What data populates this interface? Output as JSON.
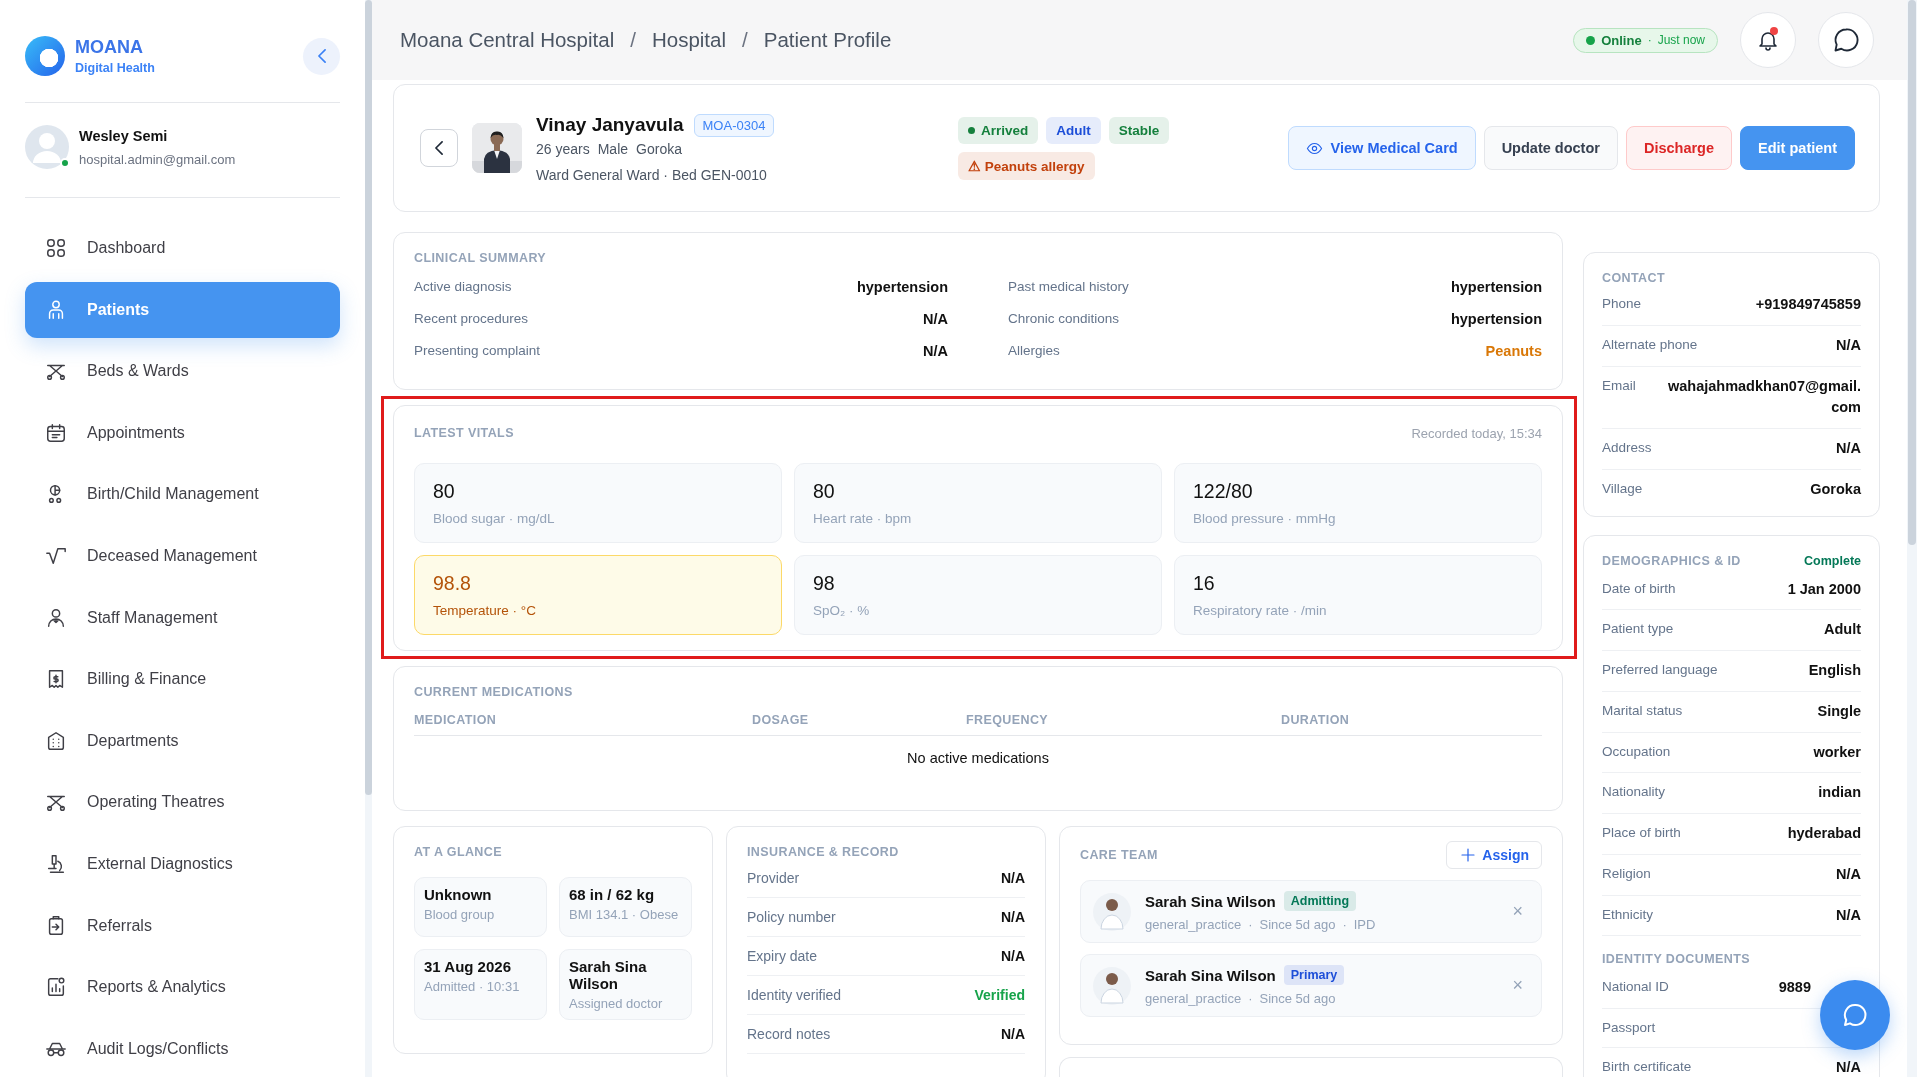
{
  "brand": {
    "name": "MOANA",
    "subtitle": "Digital Health"
  },
  "user": {
    "name": "Wesley Semi",
    "email": "hospital.admin@gmail.com",
    "online": true
  },
  "nav": [
    {
      "label": "Dashboard",
      "selected": false
    },
    {
      "label": "Patients",
      "selected": true
    },
    {
      "label": "Beds & Wards",
      "selected": false
    },
    {
      "label": "Appointments",
      "selected": false
    },
    {
      "label": "Birth/Child Management",
      "selected": false
    },
    {
      "label": "Deceased Management",
      "selected": false
    },
    {
      "label": "Staff Management",
      "selected": false
    },
    {
      "label": "Billing & Finance",
      "selected": false
    },
    {
      "label": "Departments",
      "selected": false
    },
    {
      "label": "Operating Theatres",
      "selected": false
    },
    {
      "label": "External Diagnostics",
      "selected": false
    },
    {
      "label": "Referrals",
      "selected": false
    },
    {
      "label": "Reports & Analytics",
      "selected": false
    },
    {
      "label": "Audit Logs/Conflicts",
      "selected": false
    }
  ],
  "breadcrumb": {
    "separator": "/",
    "items": [
      "Moana Central Hospital",
      "Hospital",
      "Patient Profile"
    ]
  },
  "status": {
    "label": "Online",
    "separator": "·",
    "time": "Just now",
    "online": true
  },
  "notifications": {
    "unread": true
  },
  "patient": {
    "name": "Vinay Janyavula",
    "id": "MOA-0304",
    "details": [
      "26 years",
      "Male",
      "Goroka"
    ],
    "location": "Ward General Ward · Bed GEN-0010",
    "tags": [
      {
        "label": "Arrived",
        "color": "#15803d",
        "dot": true
      },
      {
        "label": "Adult",
        "color": "#1d4ed8",
        "dot": false
      },
      {
        "label": "Stable",
        "color": "#15803d",
        "dot": false
      },
      {
        "label": "⚠ Peanuts allergy",
        "color": "#c2410c",
        "dot": false
      }
    ],
    "actions": [
      {
        "label": "View Medical Card",
        "kind": "outline"
      },
      {
        "label": "Update doctor",
        "kind": "default"
      },
      {
        "label": "Discharge",
        "kind": "danger"
      },
      {
        "label": "Edit patient",
        "kind": "primary"
      }
    ]
  },
  "clinical_summary": {
    "title": "CLINICAL SUMMARY",
    "rows": [
      {
        "label": "Active diagnosis",
        "value": "hypertension",
        "kind": "normal"
      },
      {
        "label": "Past medical history",
        "value": "hypertension",
        "kind": "normal"
      },
      {
        "label": "Recent procedures",
        "value": "N/A",
        "kind": "normal"
      },
      {
        "label": "Chronic conditions",
        "value": "hypertension",
        "kind": "normal"
      },
      {
        "label": "Presenting complaint",
        "value": "N/A",
        "kind": "normal"
      },
      {
        "label": "Allergies",
        "value": "Peanuts",
        "kind": "warning"
      }
    ]
  },
  "vitals": {
    "title": "LATEST VITALS",
    "recorded": "Recorded today, 15:34",
    "highlighted": true,
    "items": [
      {
        "value": "80",
        "label": "Blood sugar · mg/dL",
        "abnormal": false
      },
      {
        "value": "80",
        "label": "Heart rate · bpm",
        "abnormal": false
      },
      {
        "value": "122/80",
        "label": "Blood pressure · mmHg",
        "abnormal": false
      },
      {
        "value": "98.8",
        "label": "Temperature · °C",
        "abnormal": true
      },
      {
        "value": "98",
        "label": "SpO₂ · %",
        "abnormal": false
      },
      {
        "value": "16",
        "label": "Respiratory rate · /min",
        "abnormal": false
      }
    ]
  },
  "medications": {
    "title": "CURRENT MEDICATIONS",
    "columns": [
      "MEDICATION",
      "DOSAGE",
      "FREQUENCY",
      "DURATION"
    ],
    "empty": "No active medications"
  },
  "at_a_glance": {
    "title": "AT A GLANCE",
    "items": [
      {
        "value": "Unknown",
        "label": "Blood group"
      },
      {
        "value": "68 in / 62 kg",
        "label": "BMI 134.1 · Obese"
      },
      {
        "value": "31 Aug 2026",
        "label": "Admitted · 10:31"
      },
      {
        "value": "Sarah Sina Wilson",
        "label": "Assigned doctor"
      }
    ]
  },
  "insurance": {
    "title": "INSURANCE & RECORD",
    "rows": [
      {
        "label": "Provider",
        "value": "N/A",
        "kind": "normal"
      },
      {
        "label": "Policy number",
        "value": "N/A",
        "kind": "normal"
      },
      {
        "label": "Expiry date",
        "value": "N/A",
        "kind": "normal"
      },
      {
        "label": "Identity verified",
        "value": "Verified",
        "kind": "success"
      },
      {
        "label": "Record notes",
        "value": "N/A",
        "kind": "normal"
      }
    ]
  },
  "care_team": {
    "title": "CARE TEAM",
    "assign": "Assign",
    "remove": "×",
    "separator": "·",
    "members": [
      {
        "name": "Sarah Sina Wilson",
        "role": "Admitting",
        "color": "#047857",
        "details": [
          "general_practice",
          "Since 5d ago",
          "IPD"
        ]
      },
      {
        "name": "Sarah Sina Wilson",
        "role": "Primary",
        "color": "#1d4ed8",
        "details": [
          "general_practice",
          "Since 5d ago"
        ]
      }
    ]
  },
  "contact": {
    "title": "CONTACT",
    "rows": [
      {
        "label": "Phone",
        "value": "+919849745859"
      },
      {
        "label": "Alternate phone",
        "value": "N/A"
      },
      {
        "label": "Email",
        "value": "wahajahmadkhan07@gmail.com"
      },
      {
        "label": "Address",
        "value": "N/A"
      },
      {
        "label": "Village",
        "value": "Goroka"
      }
    ]
  },
  "demographics": {
    "title": "DEMOGRAPHICS & ID",
    "status": "Complete",
    "rows": [
      {
        "label": "Date of birth",
        "value": "1 Jan 2000"
      },
      {
        "label": "Patient type",
        "value": "Adult"
      },
      {
        "label": "Preferred language",
        "value": "English"
      },
      {
        "label": "Marital status",
        "value": "Single"
      },
      {
        "label": "Occupation",
        "value": "worker"
      },
      {
        "label": "Nationality",
        "value": "indian"
      },
      {
        "label": "Place of birth",
        "value": "hyderabad"
      },
      {
        "label": "Religion",
        "value": "N/A"
      },
      {
        "label": "Ethnicity",
        "value": "N/A"
      }
    ],
    "identity_title": "IDENTITY DOCUMENTS",
    "identity": [
      {
        "label": "National ID",
        "value": "9889"
      },
      {
        "label": "Passport"
      },
      {
        "label": "Birth certificate",
        "value": "N/A"
      }
    ]
  }
}
